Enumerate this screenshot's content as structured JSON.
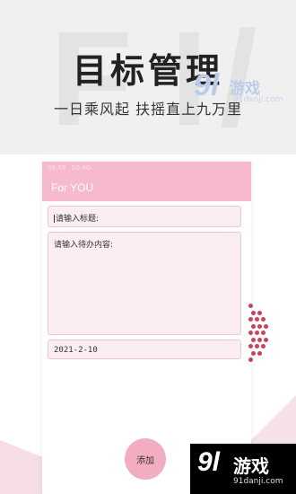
{
  "promo": {
    "headline": "目标管理",
    "subheadline": "一日乘风起 扶摇直上九万里"
  },
  "status_bar": {
    "time": "09:59",
    "indicators": "5G 4G"
  },
  "app": {
    "title": "For YOU"
  },
  "form": {
    "title_placeholder": "请输入标题:",
    "content_placeholder": "请输入待办内容:",
    "date_value": "2021-2-10",
    "add_button_label": "添加"
  },
  "watermark": {
    "brand_number": "9l",
    "brand_text": "游戏",
    "url": "91danji.com"
  },
  "colors": {
    "app_bar": "#f7b9cc",
    "field_bg": "#fbeef2",
    "button": "#f2aec0",
    "dots": "#c9425e"
  },
  "icons": {
    "dots": "dotted-pattern-decoration"
  }
}
